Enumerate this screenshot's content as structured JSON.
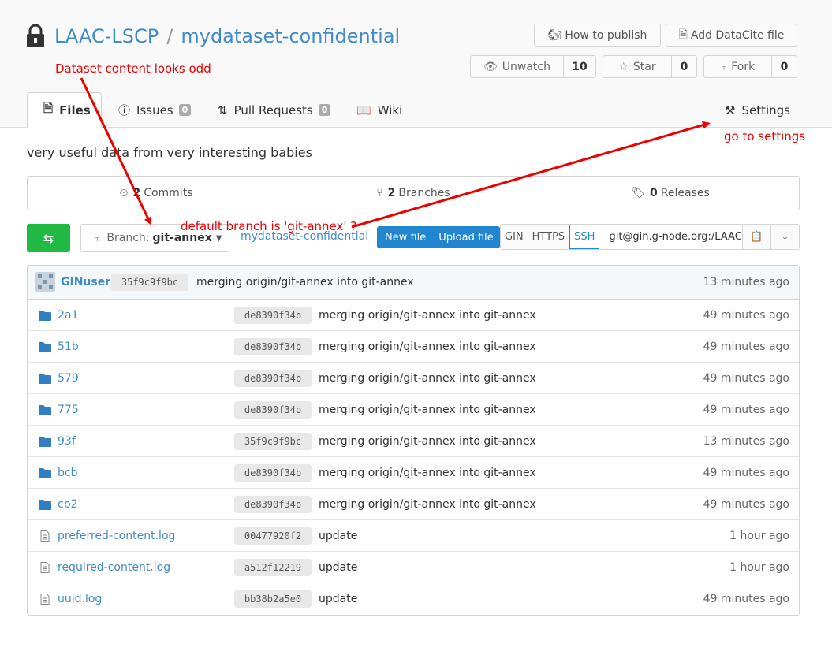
{
  "repo": {
    "owner": "LAAC-LSCP",
    "separator": "/",
    "name": "mydataset-confidential",
    "description": "very useful data from very interesting babies"
  },
  "header_buttons": {
    "how_to_publish": "How to publish",
    "add_datacite": "Add DataCite file",
    "unwatch_label": "Unwatch",
    "unwatch_count": "10",
    "star_label": "Star",
    "star_count": "0",
    "fork_label": "Fork",
    "fork_count": "0"
  },
  "tabs": {
    "files": "Files",
    "issues": "Issues",
    "issues_count": "0",
    "pull_requests": "Pull Requests",
    "pull_requests_count": "0",
    "wiki": "Wiki",
    "settings": "Settings"
  },
  "stats": {
    "commits_count": "2",
    "commits_label": "Commits",
    "branches_count": "2",
    "branches_label": "Branches",
    "releases_count": "0",
    "releases_label": "Releases"
  },
  "toolbar": {
    "branch_prefix": "Branch:",
    "branch_name": "git-annex",
    "breadcrumb_repo": "mydataset-confidential",
    "new_file": "New file",
    "upload_file": "Upload file",
    "clone_protocols": [
      "GIN",
      "HTTPS",
      "SSH"
    ],
    "active_protocol": "SSH",
    "clone_url": "git@gin.g-node.org:/LAAC-L"
  },
  "latest_commit": {
    "user": "GINuser",
    "sha": "35f9c9f9bc",
    "message": "merging origin/git-annex into git-annex",
    "age": "13 minutes ago"
  },
  "files": [
    {
      "name": "2a1",
      "type": "folder",
      "sha": "de8390f34b",
      "message": "merging origin/git-annex into git-annex",
      "age": "49 minutes ago"
    },
    {
      "name": "51b",
      "type": "folder",
      "sha": "de8390f34b",
      "message": "merging origin/git-annex into git-annex",
      "age": "49 minutes ago"
    },
    {
      "name": "579",
      "type": "folder",
      "sha": "de8390f34b",
      "message": "merging origin/git-annex into git-annex",
      "age": "49 minutes ago"
    },
    {
      "name": "775",
      "type": "folder",
      "sha": "de8390f34b",
      "message": "merging origin/git-annex into git-annex",
      "age": "49 minutes ago"
    },
    {
      "name": "93f",
      "type": "folder",
      "sha": "35f9c9f9bc",
      "message": "merging origin/git-annex into git-annex",
      "age": "13 minutes ago"
    },
    {
      "name": "bcb",
      "type": "folder",
      "sha": "de8390f34b",
      "message": "merging origin/git-annex into git-annex",
      "age": "49 minutes ago"
    },
    {
      "name": "cb2",
      "type": "folder",
      "sha": "de8390f34b",
      "message": "merging origin/git-annex into git-annex",
      "age": "49 minutes ago"
    },
    {
      "name": "preferred-content.log",
      "type": "file",
      "sha": "00477920f2",
      "message": "update",
      "age": "1 hour ago"
    },
    {
      "name": "required-content.log",
      "type": "file",
      "sha": "a512f12219",
      "message": "update",
      "age": "1 hour ago"
    },
    {
      "name": "uuid.log",
      "type": "file",
      "sha": "bb38b2a5e0",
      "message": "update",
      "age": "49 minutes ago"
    }
  ],
  "annotations": {
    "content_odd": "Dataset content looks odd",
    "default_branch": "default branch is 'git-annex' ?",
    "go_settings": "go to settings",
    "color": "#ee0000"
  }
}
